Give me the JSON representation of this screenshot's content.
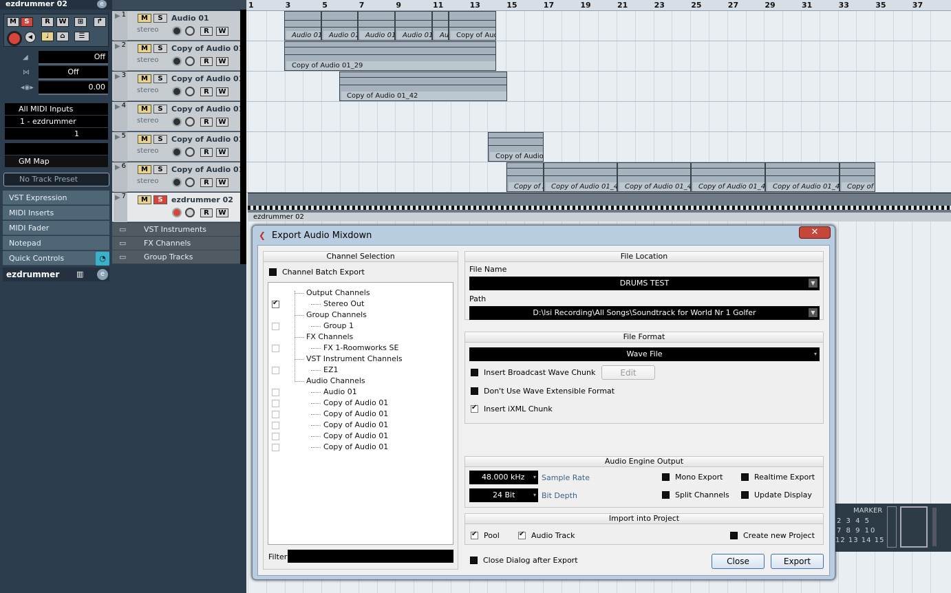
{
  "inspector": {
    "track_title": "ezdrummer 02",
    "buttons": {
      "m": "M",
      "s": "S",
      "r": "R",
      "w": "W"
    },
    "volume": "Off",
    "pan": "Off",
    "delay": "0.00",
    "input": "All MIDI Inputs",
    "output": "1 - ezdrummer",
    "channel": "1",
    "map": "GM Map",
    "preset": "No Track Preset",
    "sections": [
      "VST Expression",
      "MIDI Inserts",
      "MIDI Fader",
      "Notepad",
      "Quick Controls"
    ],
    "bottom_track": "ezdrummer"
  },
  "tracks": [
    {
      "num": "1",
      "name": "Audio 01",
      "sub": "stereo"
    },
    {
      "num": "2",
      "name": "Copy of Audio 01",
      "sub": "stereo"
    },
    {
      "num": "3",
      "name": "Copy of Audio 01",
      "sub": "stereo"
    },
    {
      "num": "4",
      "name": "Copy of Audio 01",
      "sub": "stereo"
    },
    {
      "num": "5",
      "name": "Copy of Audio 01",
      "sub": "stereo"
    },
    {
      "num": "6",
      "name": "Copy of Audio 01",
      "sub": "stereo"
    },
    {
      "num": "7",
      "name": "ezdrummer 02",
      "sub": ""
    }
  ],
  "track_buttons": {
    "m": "M",
    "s": "S",
    "r": "R",
    "w": "W"
  },
  "folders": [
    "VST Instruments",
    "FX Channels",
    "Group Tracks"
  ],
  "ruler": [
    "1",
    "3",
    "5",
    "7",
    "9",
    "11",
    "13",
    "15",
    "17",
    "19",
    "21",
    "23",
    "25",
    "27",
    "29",
    "31",
    "33",
    "35",
    "37"
  ],
  "clips": {
    "t1": [
      "Audio 01",
      "Audio 01",
      "Audio 01",
      "Audio 01",
      "Au",
      "Copy of Aud"
    ],
    "t2": "Copy of Audio 01_29",
    "t3": "Copy of Audio 01_42",
    "t5": "Copy of Audio",
    "t6": [
      "Copy of A",
      "Copy of Audio 01_4",
      "Copy of Audio 01_4",
      "Copy of Audio 01_4",
      "Copy of Audio 01_4",
      "Copy of"
    ],
    "midi": "ezdrummer 02"
  },
  "dialog": {
    "title": "Export Audio Mixdown",
    "close_x": "✕",
    "channel_selection": {
      "header": "Channel Selection",
      "batch": "Channel Batch Export",
      "tree": [
        {
          "label": "Output Channels",
          "level": 0,
          "checked": null
        },
        {
          "label": "Stereo Out",
          "level": 1,
          "checked": true
        },
        {
          "label": "Group Channels",
          "level": 0,
          "checked": null
        },
        {
          "label": "Group 1",
          "level": 1,
          "checked": false
        },
        {
          "label": "FX Channels",
          "level": 0,
          "checked": null
        },
        {
          "label": "FX 1-Roomworks SE",
          "level": 1,
          "checked": false
        },
        {
          "label": "VST Instrument Channels",
          "level": 0,
          "checked": null
        },
        {
          "label": "EZ1",
          "level": 1,
          "checked": false
        },
        {
          "label": "Audio Channels",
          "level": 0,
          "checked": null
        },
        {
          "label": "Audio 01",
          "level": 1,
          "checked": false
        },
        {
          "label": "Copy of Audio 01",
          "level": 1,
          "checked": false
        },
        {
          "label": "Copy of Audio 01",
          "level": 1,
          "checked": false
        },
        {
          "label": "Copy of Audio 01",
          "level": 1,
          "checked": false
        },
        {
          "label": "Copy of Audio 01",
          "level": 1,
          "checked": false
        },
        {
          "label": "Copy of Audio 01",
          "level": 1,
          "checked": false
        }
      ],
      "filter_label": "Filter"
    },
    "file_location": {
      "header": "File Location",
      "name_label": "File Name",
      "name_value": "DRUMS TEST",
      "path_label": "Path",
      "path_value": "D:\\lsi Recording\\All Songs\\Soundtrack for World Nr 1 Golfer"
    },
    "file_format": {
      "header": "File Format",
      "format": "Wave File",
      "opt1": "Insert Broadcast Wave Chunk",
      "edit": "Edit",
      "opt2": "Don't Use Wave Extensible Format",
      "opt3": "Insert iXML Chunk"
    },
    "engine": {
      "header": "Audio Engine Output",
      "sample_rate_value": "48.000 kHz",
      "sample_rate_label": "Sample Rate",
      "bit_depth_value": "24 Bit",
      "bit_depth_label": "Bit Depth",
      "mono": "Mono Export",
      "split": "Split Channels",
      "realtime": "Realtime Export",
      "update": "Update Display"
    },
    "import": {
      "header": "Import into Project",
      "pool": "Pool",
      "audio_track": "Audio Track",
      "new_project": "Create new Project"
    },
    "close_after": "Close Dialog after Export",
    "close_btn": "Close",
    "export_btn": "Export"
  },
  "marker": {
    "title": "MARKER",
    "rows": [
      "2 3 4 5",
      "7 8 9 10",
      "12 13 14 15"
    ]
  }
}
